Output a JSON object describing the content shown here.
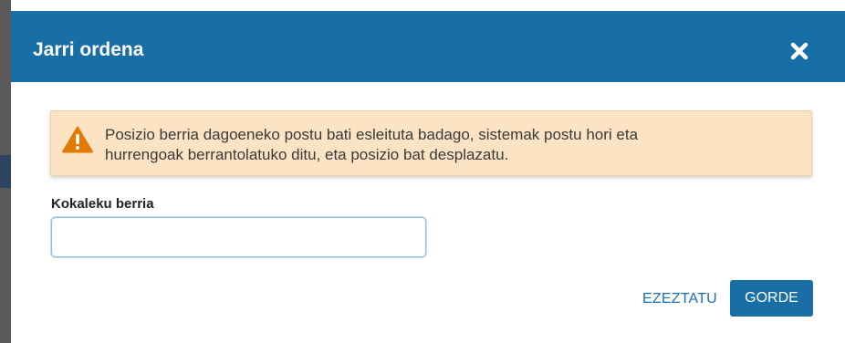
{
  "dialog": {
    "title": "Jarri ordena",
    "close_icon": "close-icon"
  },
  "alert": {
    "icon": "warning-icon",
    "line1": "Posizio berria dagoeneko postu bati esleituta badago, sistemak postu hori eta",
    "line2": "hurrengoak berrantolatuko ditu, eta posizio bat desplazatu."
  },
  "form": {
    "position_label": "Kokaleku berria",
    "position_value": ""
  },
  "footer": {
    "cancel_label": "EZEZTATU",
    "save_label": "GORDE"
  },
  "colors": {
    "header": "#176fa6",
    "alert_bg": "#fbe3c4",
    "warning": "#e07a00",
    "link": "#1a70b0"
  }
}
